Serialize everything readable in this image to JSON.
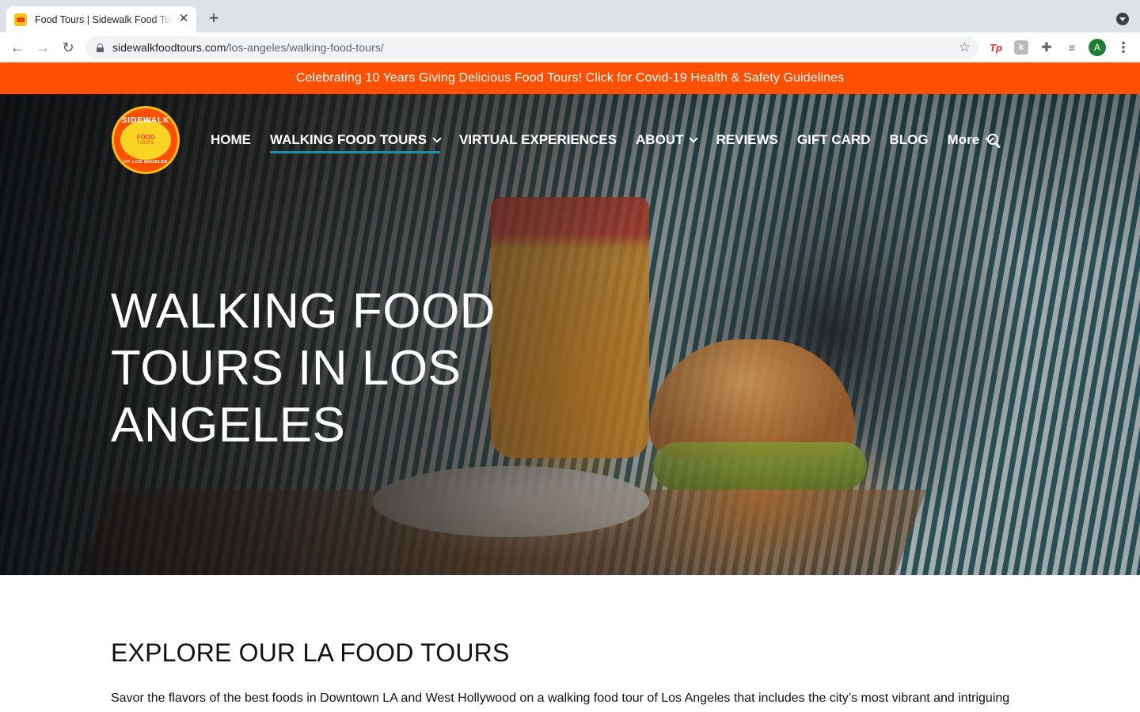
{
  "browser": {
    "tab_title": "Food Tours | Sidewalk Food Tours",
    "url_host": "sidewalkfoodtours.com",
    "url_path": "/los-angeles/walking-food-tours/",
    "avatar_letter": "A",
    "extensions": [
      "tp-icon",
      "k-extension-icon",
      "puzzle-icon",
      "media-control-icon"
    ]
  },
  "announcement": {
    "text": "Celebrating 10 Years Giving Delicious Food Tours! Click for Covid-19 Health & Safety Guidelines",
    "bg_color": "#fe5000"
  },
  "logo": {
    "top": "SIDEWALK",
    "mid": "FOOD",
    "sub": "TOURS",
    "bottom": "OF LOS ANGELES"
  },
  "nav": {
    "items": [
      {
        "label": "HOME",
        "dropdown": false,
        "active": false
      },
      {
        "label": "WALKING FOOD TOURS",
        "dropdown": true,
        "active": true
      },
      {
        "label": "VIRTUAL EXPERIENCES",
        "dropdown": false,
        "active": false
      },
      {
        "label": "ABOUT",
        "dropdown": true,
        "active": false
      },
      {
        "label": "REVIEWS",
        "dropdown": false,
        "active": false
      },
      {
        "label": "GIFT CARD",
        "dropdown": false,
        "active": false
      },
      {
        "label": "BLOG",
        "dropdown": false,
        "active": false
      },
      {
        "label": "More",
        "dropdown": true,
        "active": false
      }
    ],
    "active_underline_color": "#1a8fa6"
  },
  "hero": {
    "title": "WALKING FOOD TOURS IN LOS ANGELES"
  },
  "section": {
    "title": "EXPLORE OUR LA FOOD TOURS",
    "body": "Savor the flavors of the best foods in Downtown LA and West Hollywood on a walking food tour of Los Angeles that includes the city’s most vibrant and intriguing"
  }
}
